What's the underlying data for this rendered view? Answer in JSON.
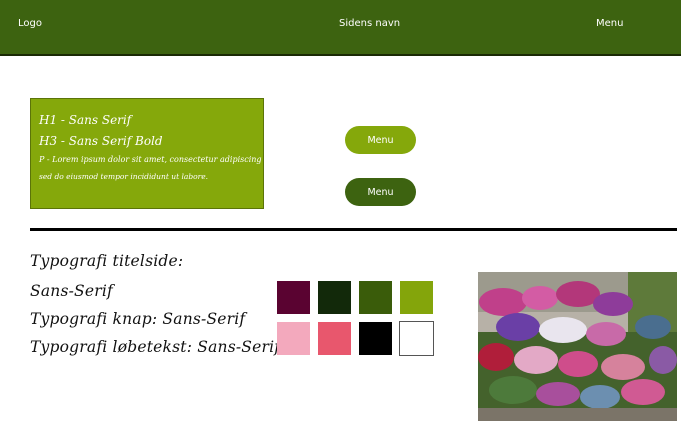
{
  "header": {
    "logo": "Logo",
    "site_name": "Sidens navn",
    "menu": "Menu",
    "background": "#3d6310"
  },
  "hero": {
    "background": "#85a80b",
    "lines": [
      "H1 - Sans Serif",
      "H3 - Sans Serif Bold",
      "P - Lorem ipsum dolor sit amet, consectetur adipiscing elit,",
      "sed do eiusmod tempor incididunt ut labore."
    ]
  },
  "buttons": [
    {
      "label": "Menu",
      "color": "#85a80b"
    },
    {
      "label": "Menu",
      "color": "#3d6310"
    }
  ],
  "typography": [
    "Typografi titelside:",
    "Sans-Serif",
    "Typografi knap: Sans-Serif",
    "Typografi løbetekst: Sans-Serif"
  ],
  "palette": [
    "#5a0331",
    "#12290a",
    "#3a5c0a",
    "#84a50b",
    "#f3a9bd",
    "#e8576d",
    "#000000",
    "#ffffff"
  ],
  "photo": {
    "subject": "flower-market-photo"
  }
}
